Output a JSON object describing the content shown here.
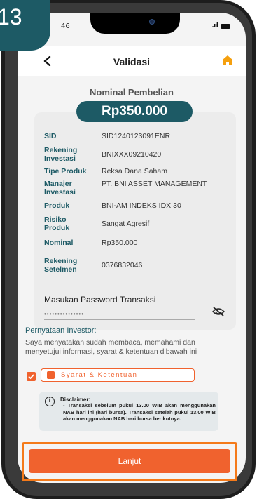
{
  "step_badge": "13",
  "status_bar": {
    "time": "46",
    "signal": ".ııl"
  },
  "header": {
    "title": "Validasi"
  },
  "purchase": {
    "nominal_label": "Nominal Pembelian",
    "amount": "Rp350.000"
  },
  "details": [
    {
      "label": "SID",
      "value": "SID1240123091ENR"
    },
    {
      "label": "Rekening Investasi",
      "value": "BNIXXX09210420"
    },
    {
      "label": "Tipe Produk",
      "value": "Reksa Dana Saham"
    },
    {
      "label": "Manajer Investasi",
      "value": "PT. BNI ASSET MANAGEMENT"
    },
    {
      "label": "Produk",
      "value": "BNI-AM INDEKS IDX 30"
    },
    {
      "label": "Risiko Produk",
      "value": "Sangat Agresif"
    },
    {
      "label": "Nominal",
      "value": "Rp350.000"
    },
    {
      "label": "Rekening Setelmen",
      "value": "0376832046"
    }
  ],
  "password": {
    "label": "Masukan Password Transaksi",
    "value": "•••••••••••••••"
  },
  "pernyataan": {
    "title": "Pernyataan Investor:",
    "text": "Saya menyatakan sudah membaca, memahami dan menyetujui informasi, syarat & ketentuan dibawah ini"
  },
  "terms": {
    "label": "Syarat & Ketentuan",
    "checked": true
  },
  "disclaimer": {
    "title": "Disclaimer:",
    "items": [
      "- Transaksi sebelum pukul 13.00 WIB akan menggunakan NAB hari ini (hari bursa). Transaksi setelah pukul 13.00 WIB akan menggunakan NAB hari bursa berikutnya."
    ]
  },
  "actions": {
    "submit_label": "Lanjut"
  },
  "colors": {
    "primary": "#1d5a65",
    "accent": "#f0622e",
    "highlight_frame": "#f47a1a"
  }
}
